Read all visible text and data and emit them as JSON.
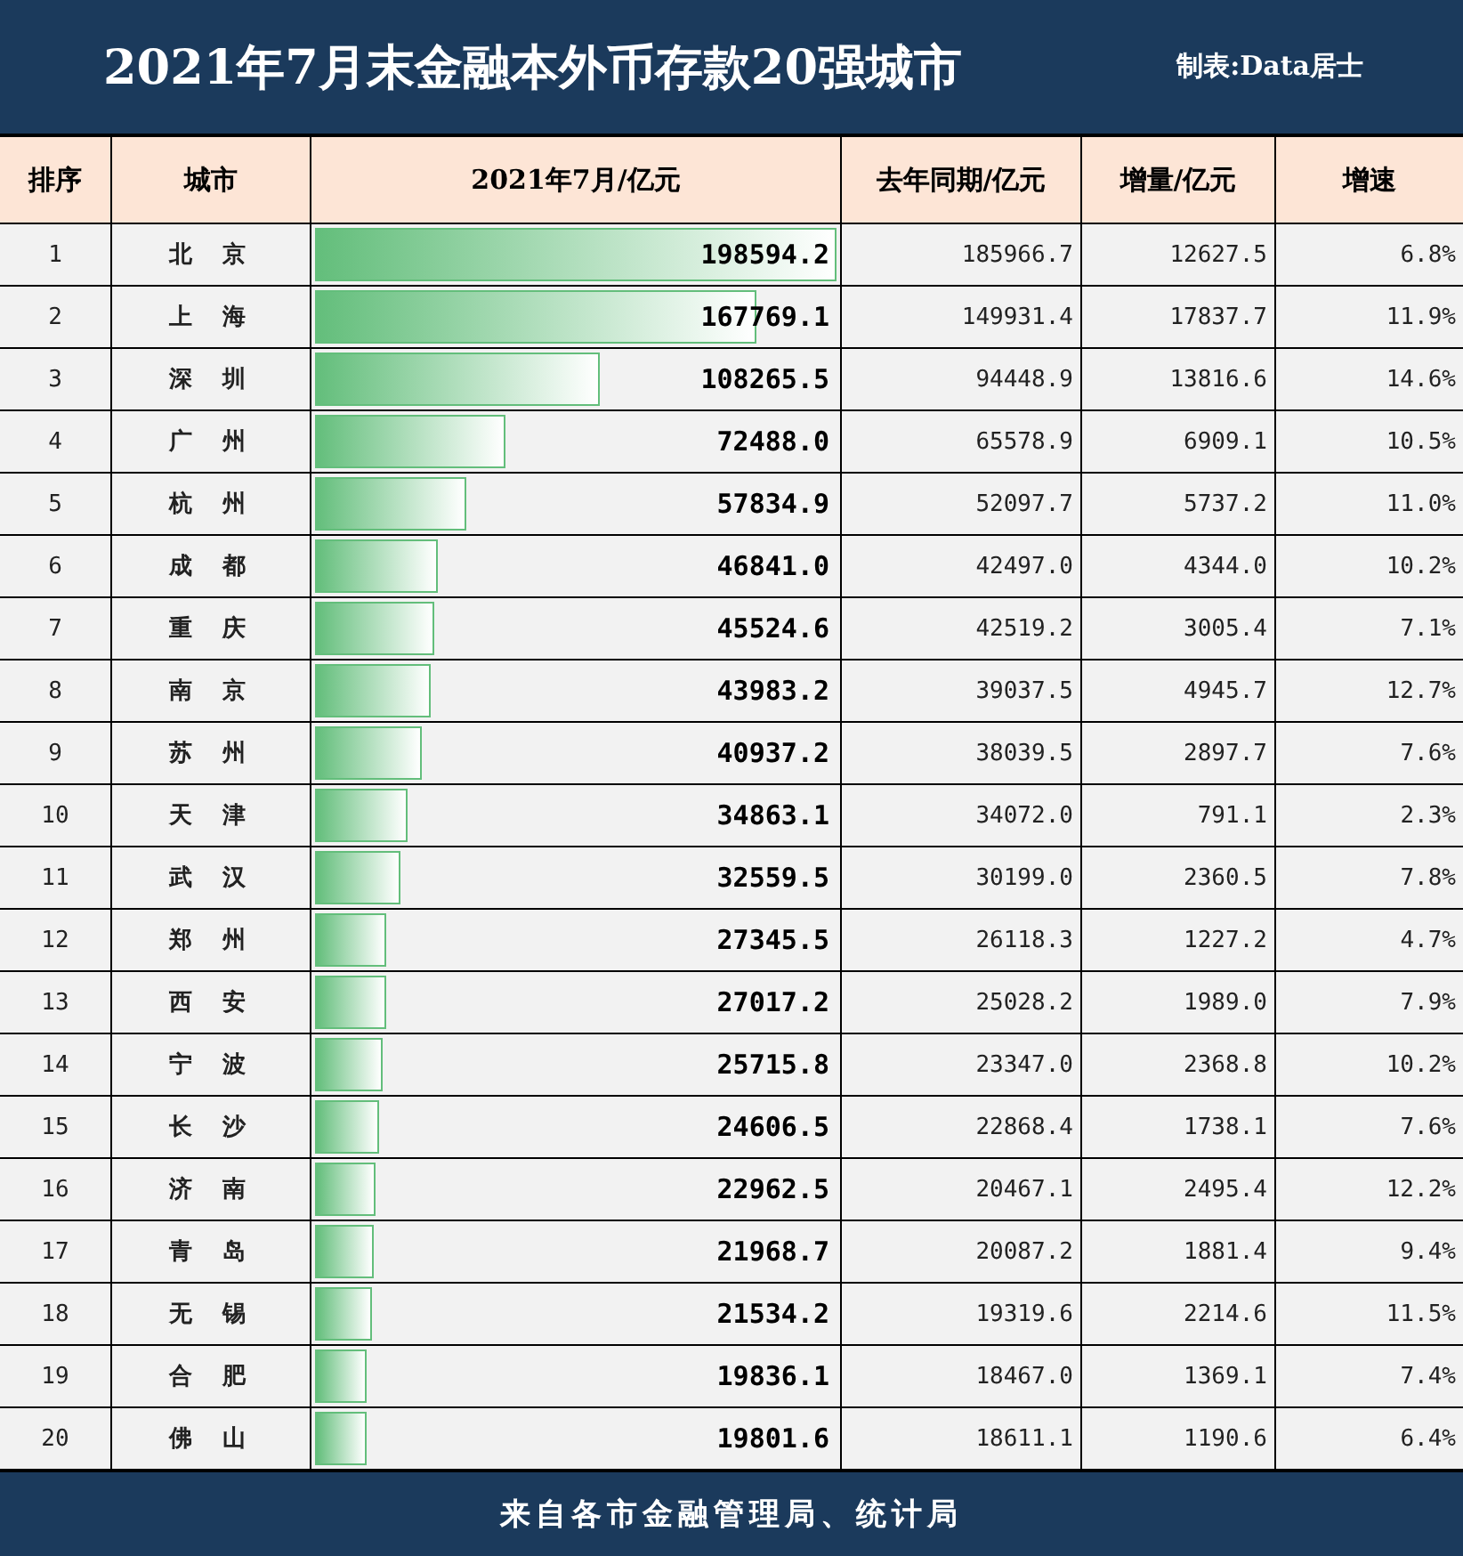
{
  "header": {
    "title": "2021年7月末金融本外币存款20强城市",
    "credit": "制表:Data居士"
  },
  "table": {
    "columns": [
      "排序",
      "城市",
      "2021年7月/亿元",
      "去年同期/亿元",
      "增量/亿元",
      "增速"
    ],
    "rows": [
      {
        "rank": "1",
        "city": "北京",
        "value": "198594.2",
        "level": 1.0,
        "last_year": "185966.7",
        "increase": "12627.5",
        "growth": "6.8%"
      },
      {
        "rank": "2",
        "city": "上海",
        "value": "167769.1",
        "level": 0.845,
        "last_year": "149931.4",
        "increase": "17837.7",
        "growth": "11.9%"
      },
      {
        "rank": "3",
        "city": "深圳",
        "value": "108265.5",
        "level": 0.545,
        "last_year": "94448.9",
        "increase": "13816.6",
        "growth": "14.6%"
      },
      {
        "rank": "4",
        "city": "广州",
        "value": "72488.0",
        "level": 0.365,
        "last_year": "65578.9",
        "increase": "6909.1",
        "growth": "10.5%"
      },
      {
        "rank": "5",
        "city": "杭州",
        "value": "57834.9",
        "level": 0.291,
        "last_year": "52097.7",
        "increase": "5737.2",
        "growth": "11.0%"
      },
      {
        "rank": "6",
        "city": "成都",
        "value": "46841.0",
        "level": 0.236,
        "last_year": "42497.0",
        "increase": "4344.0",
        "growth": "10.2%"
      },
      {
        "rank": "7",
        "city": "重庆",
        "value": "45524.6",
        "level": 0.229,
        "last_year": "42519.2",
        "increase": "3005.4",
        "growth": "7.1%"
      },
      {
        "rank": "8",
        "city": "南京",
        "value": "43983.2",
        "level": 0.221,
        "last_year": "39037.5",
        "increase": "4945.7",
        "growth": "12.7%"
      },
      {
        "rank": "9",
        "city": "苏州",
        "value": "40937.2",
        "level": 0.206,
        "last_year": "38039.5",
        "increase": "2897.7",
        "growth": "7.6%"
      },
      {
        "rank": "10",
        "city": "天津",
        "value": "34863.1",
        "level": 0.176,
        "last_year": "34072.0",
        "increase": "791.1",
        "growth": "2.3%"
      },
      {
        "rank": "11",
        "city": "武汉",
        "value": "32559.5",
        "level": 0.164,
        "last_year": "30199.0",
        "increase": "2360.5",
        "growth": "7.8%"
      },
      {
        "rank": "12",
        "city": "郑州",
        "value": "27345.5",
        "level": 0.138,
        "last_year": "26118.3",
        "increase": "1227.2",
        "growth": "4.7%"
      },
      {
        "rank": "13",
        "city": "西安",
        "value": "27017.2",
        "level": 0.136,
        "last_year": "25028.2",
        "increase": "1989.0",
        "growth": "7.9%"
      },
      {
        "rank": "14",
        "city": "宁波",
        "value": "25715.8",
        "level": 0.129,
        "last_year": "23347.0",
        "increase": "2368.8",
        "growth": "10.2%"
      },
      {
        "rank": "15",
        "city": "长沙",
        "value": "24606.5",
        "level": 0.124,
        "last_year": "22868.4",
        "increase": "1738.1",
        "growth": "7.6%"
      },
      {
        "rank": "16",
        "city": "济南",
        "value": "22962.5",
        "level": 0.116,
        "last_year": "20467.1",
        "increase": "2495.4",
        "growth": "12.2%"
      },
      {
        "rank": "17",
        "city": "青岛",
        "value": "21968.7",
        "level": 0.111,
        "last_year": "20087.2",
        "increase": "1881.4",
        "growth": "9.4%"
      },
      {
        "rank": "18",
        "city": "无锡",
        "value": "21534.2",
        "level": 0.108,
        "last_year": "19319.6",
        "increase": "2214.6",
        "growth": "11.5%"
      },
      {
        "rank": "19",
        "city": "合肥",
        "value": "19836.1",
        "level": 0.1,
        "last_year": "18467.0",
        "increase": "1369.1",
        "growth": "7.4%"
      },
      {
        "rank": "20",
        "city": "佛山",
        "value": "19801.6",
        "level": 0.1,
        "last_year": "18611.1",
        "increase": "1190.6",
        "growth": "6.4%"
      }
    ]
  },
  "footer": {
    "source": "来自各市金融管理局、统计局"
  }
}
